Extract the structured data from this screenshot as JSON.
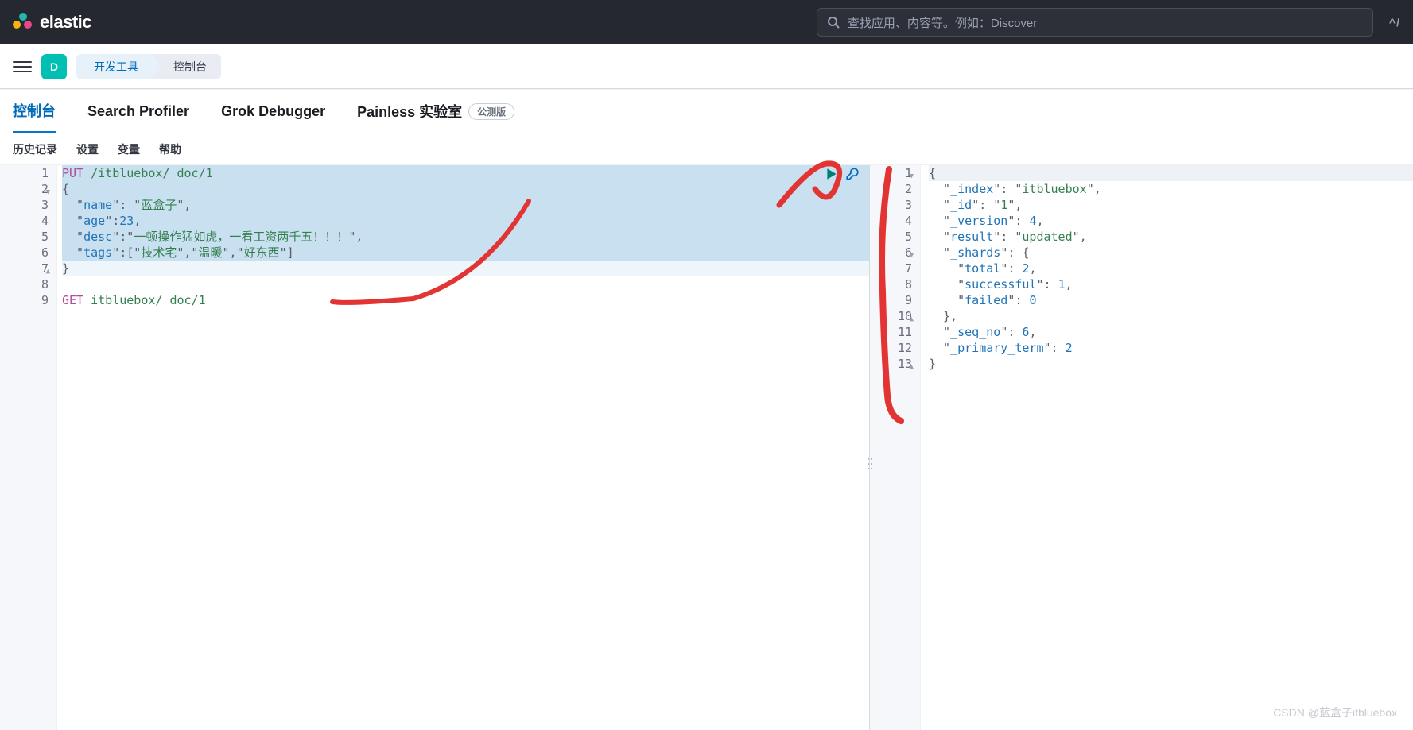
{
  "header": {
    "brand": "elastic",
    "search_placeholder": "查找应用、内容等。例如：Discover",
    "cmd_hint": "^/"
  },
  "subheader": {
    "space_initial": "D",
    "breadcrumb": [
      "开发工具",
      "控制台"
    ]
  },
  "tabs": [
    {
      "label": "控制台",
      "active": true
    },
    {
      "label": "Search Profiler",
      "active": false
    },
    {
      "label": "Grok Debugger",
      "active": false
    },
    {
      "label": "Painless 实验室",
      "active": false,
      "badge": "公测版"
    }
  ],
  "toolbelt": [
    "历史记录",
    "设置",
    "变量",
    "帮助"
  ],
  "editor": {
    "lines": [
      {
        "n": 1,
        "fold": "",
        "hl": "block",
        "tokens": [
          {
            "t": "PUT ",
            "c": "method"
          },
          {
            "t": "/itbluebox/_doc/1",
            "c": "path"
          }
        ]
      },
      {
        "n": 2,
        "fold": "▼",
        "hl": "block",
        "tokens": [
          {
            "t": "{",
            "c": "punc"
          }
        ]
      },
      {
        "n": 3,
        "fold": "",
        "hl": "block",
        "tokens": [
          {
            "t": "  \"",
            "c": "punc"
          },
          {
            "t": "name",
            "c": "key"
          },
          {
            "t": "\": \"",
            "c": "punc"
          },
          {
            "t": "蓝盒子",
            "c": "str"
          },
          {
            "t": "\",",
            "c": "punc"
          }
        ]
      },
      {
        "n": 4,
        "fold": "",
        "hl": "block",
        "tokens": [
          {
            "t": "  \"",
            "c": "punc"
          },
          {
            "t": "age",
            "c": "key"
          },
          {
            "t": "\":",
            "c": "punc"
          },
          {
            "t": "23",
            "c": "num"
          },
          {
            "t": ",",
            "c": "punc"
          }
        ]
      },
      {
        "n": 5,
        "fold": "",
        "hl": "block",
        "tokens": [
          {
            "t": "  \"",
            "c": "punc"
          },
          {
            "t": "desc",
            "c": "key"
          },
          {
            "t": "\":\"",
            "c": "punc"
          },
          {
            "t": "一顿操作猛如虎，一看工资两千五！！！",
            "c": "str"
          },
          {
            "t": "\",",
            "c": "punc"
          }
        ]
      },
      {
        "n": 6,
        "fold": "",
        "hl": "block",
        "tokens": [
          {
            "t": "  \"",
            "c": "punc"
          },
          {
            "t": "tags",
            "c": "key"
          },
          {
            "t": "\":[\"",
            "c": "punc"
          },
          {
            "t": "技术宅",
            "c": "str"
          },
          {
            "t": "\",\"",
            "c": "punc"
          },
          {
            "t": "温暖",
            "c": "str"
          },
          {
            "t": "\",\"",
            "c": "punc"
          },
          {
            "t": "好东西",
            "c": "str"
          },
          {
            "t": "\"]",
            "c": "punc"
          }
        ]
      },
      {
        "n": 7,
        "fold": "▲",
        "hl": "light",
        "tokens": [
          {
            "t": "}",
            "c": "punc"
          }
        ]
      },
      {
        "n": 8,
        "fold": "",
        "hl": "",
        "tokens": []
      },
      {
        "n": 9,
        "fold": "",
        "hl": "",
        "tokens": [
          {
            "t": "GET ",
            "c": "method"
          },
          {
            "t": "itbluebox/_doc/1",
            "c": "path"
          }
        ]
      }
    ]
  },
  "response": {
    "lines": [
      {
        "n": 1,
        "fold": "▼",
        "tokens": [
          {
            "t": "{",
            "c": "punc"
          }
        ]
      },
      {
        "n": 2,
        "fold": "",
        "tokens": [
          {
            "t": "  \"",
            "c": "punc"
          },
          {
            "t": "_index",
            "c": "key"
          },
          {
            "t": "\": \"",
            "c": "punc"
          },
          {
            "t": "itbluebox",
            "c": "str"
          },
          {
            "t": "\",",
            "c": "punc"
          }
        ]
      },
      {
        "n": 3,
        "fold": "",
        "tokens": [
          {
            "t": "  \"",
            "c": "punc"
          },
          {
            "t": "_id",
            "c": "key"
          },
          {
            "t": "\": \"",
            "c": "punc"
          },
          {
            "t": "1",
            "c": "str"
          },
          {
            "t": "\",",
            "c": "punc"
          }
        ]
      },
      {
        "n": 4,
        "fold": "",
        "tokens": [
          {
            "t": "  \"",
            "c": "punc"
          },
          {
            "t": "_version",
            "c": "key"
          },
          {
            "t": "\": ",
            "c": "punc"
          },
          {
            "t": "4",
            "c": "num"
          },
          {
            "t": ",",
            "c": "punc"
          }
        ]
      },
      {
        "n": 5,
        "fold": "",
        "tokens": [
          {
            "t": "  \"",
            "c": "punc"
          },
          {
            "t": "result",
            "c": "key"
          },
          {
            "t": "\": \"",
            "c": "punc"
          },
          {
            "t": "updated",
            "c": "str"
          },
          {
            "t": "\",",
            "c": "punc"
          }
        ]
      },
      {
        "n": 6,
        "fold": "▼",
        "tokens": [
          {
            "t": "  \"",
            "c": "punc"
          },
          {
            "t": "_shards",
            "c": "key"
          },
          {
            "t": "\": {",
            "c": "punc"
          }
        ]
      },
      {
        "n": 7,
        "fold": "",
        "tokens": [
          {
            "t": "    \"",
            "c": "punc"
          },
          {
            "t": "total",
            "c": "key"
          },
          {
            "t": "\": ",
            "c": "punc"
          },
          {
            "t": "2",
            "c": "num"
          },
          {
            "t": ",",
            "c": "punc"
          }
        ]
      },
      {
        "n": 8,
        "fold": "",
        "tokens": [
          {
            "t": "    \"",
            "c": "punc"
          },
          {
            "t": "successful",
            "c": "key"
          },
          {
            "t": "\": ",
            "c": "punc"
          },
          {
            "t": "1",
            "c": "num"
          },
          {
            "t": ",",
            "c": "punc"
          }
        ]
      },
      {
        "n": 9,
        "fold": "",
        "tokens": [
          {
            "t": "    \"",
            "c": "punc"
          },
          {
            "t": "failed",
            "c": "key"
          },
          {
            "t": "\": ",
            "c": "punc"
          },
          {
            "t": "0",
            "c": "num"
          }
        ]
      },
      {
        "n": 10,
        "fold": "▲",
        "tokens": [
          {
            "t": "  },",
            "c": "punc"
          }
        ]
      },
      {
        "n": 11,
        "fold": "",
        "tokens": [
          {
            "t": "  \"",
            "c": "punc"
          },
          {
            "t": "_seq_no",
            "c": "key"
          },
          {
            "t": "\": ",
            "c": "punc"
          },
          {
            "t": "6",
            "c": "num"
          },
          {
            "t": ",",
            "c": "punc"
          }
        ]
      },
      {
        "n": 12,
        "fold": "",
        "tokens": [
          {
            "t": "  \"",
            "c": "punc"
          },
          {
            "t": "_primary_term",
            "c": "key"
          },
          {
            "t": "\": ",
            "c": "punc"
          },
          {
            "t": "2",
            "c": "num"
          }
        ]
      },
      {
        "n": 13,
        "fold": "▲",
        "tokens": [
          {
            "t": "}",
            "c": "punc"
          }
        ]
      }
    ]
  },
  "watermark": "CSDN @蓝盒子itbluebox"
}
